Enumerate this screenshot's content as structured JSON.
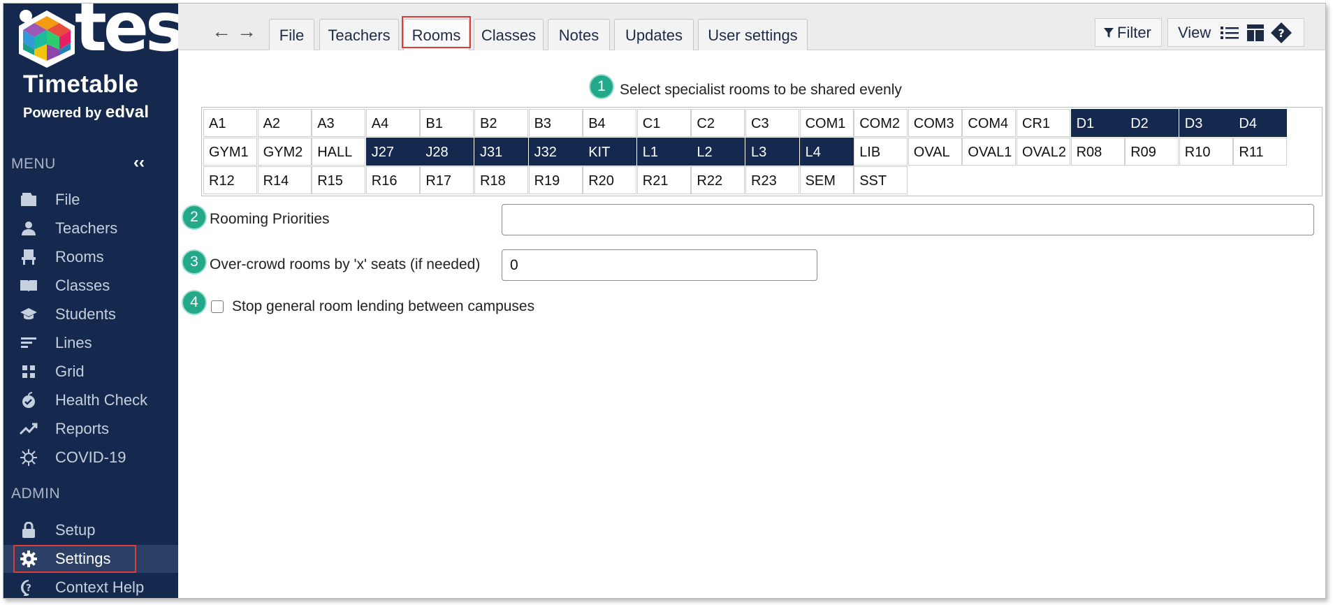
{
  "brand": {
    "logo_word": "tes",
    "product": "Timetable",
    "powered_by": "Powered by",
    "powered_brand": "edval"
  },
  "sidebar": {
    "menu_title": "MENU",
    "collapse_icon": "double-chevron-left",
    "admin_title": "ADMIN",
    "menu_items": [
      {
        "label": "File",
        "icon": "folder-icon"
      },
      {
        "label": "Teachers",
        "icon": "person-icon"
      },
      {
        "label": "Rooms",
        "icon": "chair-icon"
      },
      {
        "label": "Classes",
        "icon": "book-icon"
      },
      {
        "label": "Students",
        "icon": "graduation-cap-icon"
      },
      {
        "label": "Lines",
        "icon": "lines-icon"
      },
      {
        "label": "Grid",
        "icon": "grid-icon"
      },
      {
        "label": "Health Check",
        "icon": "apple-check-icon"
      },
      {
        "label": "Reports",
        "icon": "trend-icon"
      },
      {
        "label": "COVID-19",
        "icon": "virus-icon"
      }
    ],
    "admin_items": [
      {
        "label": "Setup",
        "icon": "lock-icon"
      },
      {
        "label": "Settings",
        "icon": "gear-icon",
        "active": true
      },
      {
        "label": "Context Help",
        "icon": "help-bubble-icon"
      }
    ]
  },
  "toolbar": {
    "tabs": [
      "File",
      "Teachers",
      "Rooms",
      "Classes",
      "Notes",
      "Updates",
      "User settings"
    ],
    "active_tab": "Rooms",
    "filter_label": "Filter",
    "view_label": "View"
  },
  "content": {
    "heading": "Select specialist rooms to be shared evenly",
    "badges": [
      "1",
      "2",
      "3",
      "4"
    ],
    "rooms": [
      {
        "name": "A1",
        "selected": false
      },
      {
        "name": "A2",
        "selected": false
      },
      {
        "name": "A3",
        "selected": false
      },
      {
        "name": "A4",
        "selected": false
      },
      {
        "name": "B1",
        "selected": false
      },
      {
        "name": "B2",
        "selected": false
      },
      {
        "name": "B3",
        "selected": false
      },
      {
        "name": "B4",
        "selected": false
      },
      {
        "name": "C1",
        "selected": false
      },
      {
        "name": "C2",
        "selected": false
      },
      {
        "name": "C3",
        "selected": false
      },
      {
        "name": "COM1",
        "selected": false
      },
      {
        "name": "COM2",
        "selected": false
      },
      {
        "name": "COM3",
        "selected": false
      },
      {
        "name": "COM4",
        "selected": false
      },
      {
        "name": "CR1",
        "selected": false
      },
      {
        "name": "D1",
        "selected": true
      },
      {
        "name": "D2",
        "selected": true
      },
      {
        "name": "D3",
        "selected": true
      },
      {
        "name": "D4",
        "selected": true
      },
      {
        "name": "GYM1",
        "selected": false
      },
      {
        "name": "GYM2",
        "selected": false
      },
      {
        "name": "HALL",
        "selected": false
      },
      {
        "name": "J27",
        "selected": true
      },
      {
        "name": "J28",
        "selected": true
      },
      {
        "name": "J31",
        "selected": true
      },
      {
        "name": "J32",
        "selected": true
      },
      {
        "name": "KIT",
        "selected": true
      },
      {
        "name": "L1",
        "selected": true
      },
      {
        "name": "L2",
        "selected": true
      },
      {
        "name": "L3",
        "selected": true
      },
      {
        "name": "L4",
        "selected": true
      },
      {
        "name": "LIB",
        "selected": false
      },
      {
        "name": "OVAL",
        "selected": false
      },
      {
        "name": "OVAL1",
        "selected": false
      },
      {
        "name": "OVAL2",
        "selected": false
      },
      {
        "name": "R08",
        "selected": false
      },
      {
        "name": "R09",
        "selected": false
      },
      {
        "name": "R10",
        "selected": false
      },
      {
        "name": "R11",
        "selected": false
      },
      {
        "name": "R12",
        "selected": false
      },
      {
        "name": "R14",
        "selected": false
      },
      {
        "name": "R15",
        "selected": false
      },
      {
        "name": "R16",
        "selected": false
      },
      {
        "name": "R17",
        "selected": false
      },
      {
        "name": "R18",
        "selected": false
      },
      {
        "name": "R19",
        "selected": false
      },
      {
        "name": "R20",
        "selected": false
      },
      {
        "name": "R21",
        "selected": false
      },
      {
        "name": "R22",
        "selected": false
      },
      {
        "name": "R23",
        "selected": false
      },
      {
        "name": "SEM",
        "selected": false
      },
      {
        "name": "SST",
        "selected": false
      }
    ],
    "rooming_priorities_label": "Rooming Priorities",
    "rooming_priorities_value": "",
    "overcrowd_label": "Over-crowd rooms by 'x' seats (if needed)",
    "overcrowd_value": "0",
    "stop_lending_label": "Stop general room lending between campuses",
    "stop_lending_checked": false
  },
  "colors": {
    "sidebar_bg": "#14294d",
    "selected_room_bg": "#15294f",
    "badge": "#23a889",
    "highlight": "#e03b3b"
  }
}
